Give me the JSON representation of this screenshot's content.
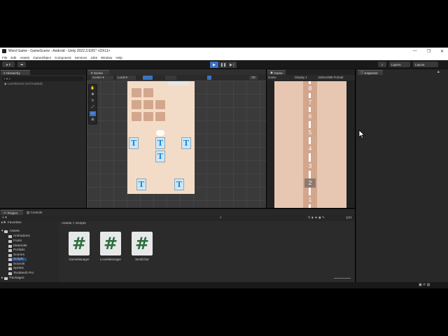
{
  "window": {
    "title": "Word Game - GameScene - Android - Unity 2022.3.62f1* <DX11>",
    "controls": [
      "—",
      "❐",
      "✕"
    ]
  },
  "menu": [
    "File",
    "Edit",
    "Assets",
    "GameObject",
    "Component",
    "Services",
    "Jobs",
    "Window",
    "Help"
  ],
  "toolbar": {
    "account": "F",
    "layers": "Layers",
    "layout": "Layout"
  },
  "hierarchy": {
    "tab": "Hierarchy",
    "item": "LevelScene (not loaded)"
  },
  "scene": {
    "tab": "Scene",
    "pivot": "Center",
    "space": "Local",
    "mode": "2D",
    "tiles": [
      "T",
      "T",
      "T",
      "T",
      "T",
      "T"
    ]
  },
  "game": {
    "tab": "Game",
    "mode": "Game",
    "display": "Display 1",
    "resolution": "1920x1080 Portrait",
    "numbers": [
      "8",
      "7",
      "6",
      "5",
      "4",
      "3",
      "2",
      "1"
    ]
  },
  "inspector": {
    "tab": "Inspector"
  },
  "project": {
    "tab": "Project",
    "console_tab": "Console",
    "favorites": "Favorites",
    "assets": "Assets",
    "folders": [
      "Animations",
      "Fonts",
      "Materials",
      "Prefabs",
      "Scenes",
      "Scripts",
      "Sounds",
      "Sprites",
      "TextMesh Pro"
    ],
    "packages": "Packages",
    "breadcrumb": [
      "Assets",
      "Scripts"
    ],
    "scripts": [
      "GameManager",
      "LevelsManager",
      "SendChar"
    ],
    "script_glyph": "#",
    "count": "21"
  },
  "colors": {
    "editor_bg": "#282828",
    "board": "#f3dcc7",
    "tile": "#d3a78d",
    "game_bg": "#e7c7b1",
    "play_accent": "#3a72c2"
  }
}
